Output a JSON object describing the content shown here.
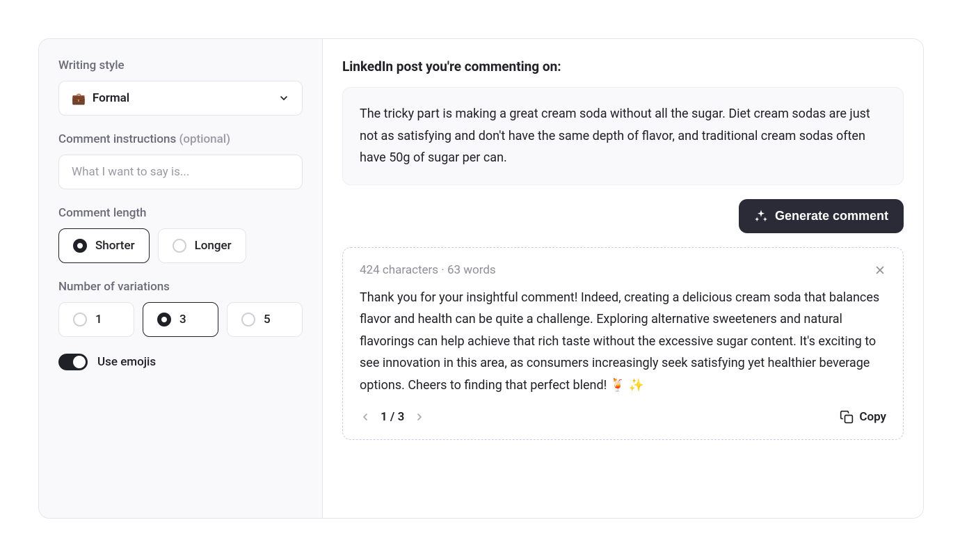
{
  "sidebar": {
    "writingStyle": {
      "label": "Writing style",
      "selected": "Formal",
      "icon": "💼"
    },
    "instructions": {
      "label": "Comment instructions ",
      "optional": "(optional)",
      "placeholder": "What I want to say is..."
    },
    "length": {
      "label": "Comment length",
      "options": [
        "Shorter",
        "Longer"
      ],
      "selected": "Shorter"
    },
    "variations": {
      "label": "Number of variations",
      "options": [
        "1",
        "3",
        "5"
      ],
      "selected": "3"
    },
    "emojis": {
      "label": "Use emojis",
      "on": true
    }
  },
  "main": {
    "title": "LinkedIn post you're commenting on:",
    "post": "The tricky part is making a great cream soda without all the sugar. Diet cream sodas are just not as satisfying and don't have the same depth of flavor, and traditional cream sodas often have 50g of sugar per can.",
    "generateLabel": "Generate comment",
    "result": {
      "stats": "424 characters · 63 words",
      "text": "Thank you for your insightful comment! Indeed, creating a delicious cream soda that balances flavor and health can be quite a challenge. Exploring alternative sweeteners and natural flavorings can help achieve that rich taste without the excessive sugar content. It's exciting to see innovation in this area, as consumers increasingly seek satisfying yet healthier beverage options. Cheers to finding that perfect blend! 🍹 ✨",
      "pagination": "1 / 3",
      "copyLabel": "Copy"
    }
  }
}
